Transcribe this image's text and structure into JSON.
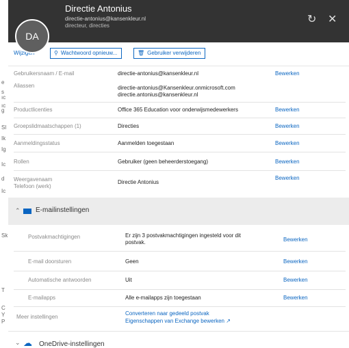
{
  "header": {
    "initials": "DA",
    "name": "Directie Antonius",
    "email": "directie-antonius@kansenkleur.nl",
    "subtitle": "directeur, directies"
  },
  "toolbar": {
    "edit_label": "Wijzigen",
    "reset_password_label": "Wachtwoord opnieuw...",
    "delete_user_label": "Gebruiker verwijderen"
  },
  "fields": [
    {
      "label": "Gebruikersnaam / E-mail",
      "value": "directie-antonius@kansenkleur.nl",
      "action": "Bewerken"
    },
    {
      "label": "Aliassen",
      "value": "directie-antonius@Kansenkleur.onmicrosoft.com",
      "value2": "directie.antonius@kansenkleur.nl"
    },
    {
      "label": "Productlicenties",
      "value": "Office 365 Education voor onderwijsmedewerkers",
      "action": "Bewerken"
    },
    {
      "label": "Groepslidmaatschappen (1)",
      "value": "Directies",
      "action": "Bewerken"
    },
    {
      "label": "Aanmeldingsstatus",
      "value": "Aanmelden toegestaan",
      "action": "Bewerken"
    },
    {
      "label": "Rollen",
      "value": "Gebruiker (geen beheerderstoegang)",
      "action": "Bewerken"
    },
    {
      "label": "Weergavenaam",
      "label2": "Telefoon (werk)",
      "value": "Directie Antonius",
      "action": "Bewerken"
    }
  ],
  "mail_section": {
    "title": "E-mailinstellingen",
    "rows": [
      {
        "label": "Postvakmachtigingen",
        "value": "Er zijn 3 postvakmachtigingen ingesteld voor dit",
        "value2": "postvak.",
        "action": "Bewerken"
      },
      {
        "label": "E-mail doorsturen",
        "value": "Geen",
        "action": "Bewerken"
      },
      {
        "label": "Automatische antwoorden",
        "value": "Uit",
        "action": "Bewerken"
      },
      {
        "label": "E-mailapps",
        "value": "Alle e-mailapps zijn toegestaan",
        "action": "Bewerken"
      }
    ],
    "more_label": "Meer instellingen",
    "more_link1": "Converteren naar gedeeld postvak",
    "more_link2": "Eigenschappen van Exchange bewerken"
  },
  "onedrive_section": {
    "title": "OneDrive-instellingen"
  },
  "left_strip_chars": [
    "e",
    "s",
    "ıc",
    "ıc",
    "g",
    "Sl",
    "Ik",
    "Ig",
    "Ic",
    "d",
    "Ic",
    "Sk",
    "T",
    "C",
    "Y",
    "P"
  ],
  "colors": {
    "header_bg": "#333333",
    "accent": "#0a65c1"
  }
}
